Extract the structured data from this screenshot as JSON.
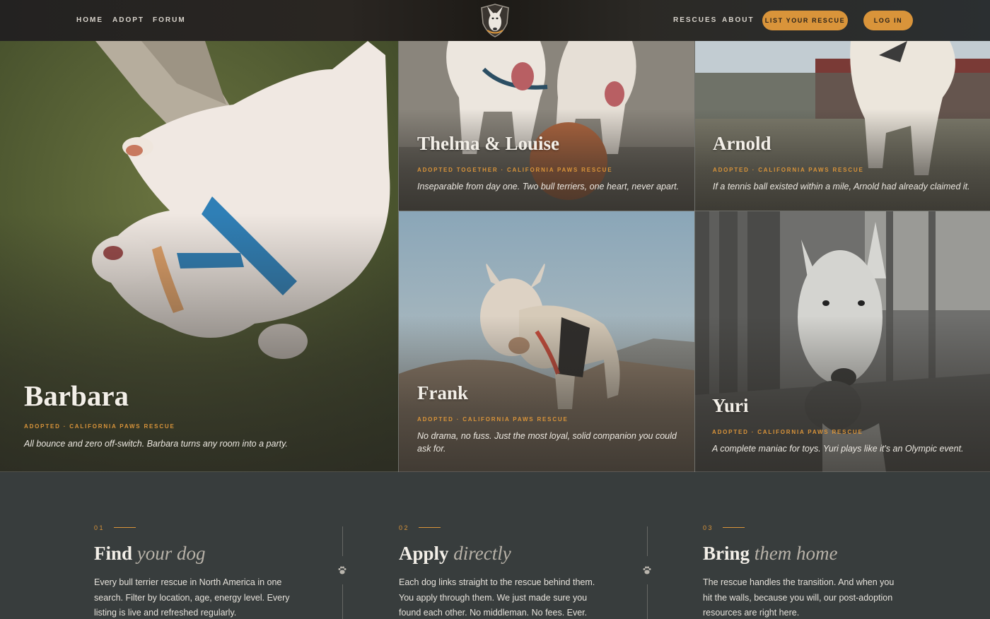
{
  "nav": {
    "left": [
      "HOME",
      "ADOPT",
      "FORUM"
    ],
    "right": [
      "RESCUES",
      "ABOUT"
    ],
    "cta": "LIST YOUR RESCUE",
    "login": "LOG IN",
    "logo_icon": "bull-terrier-shield-logo"
  },
  "colors": {
    "accent": "#d9943a",
    "background": "#383d3d",
    "text": "#f3efe8"
  },
  "dogs": [
    {
      "name": "Barbara",
      "tag": "ADOPTED · CALIFORNIA PAWS RESCUE",
      "desc": "All bounce and zero off-switch. Barbara turns any room into a party."
    },
    {
      "name": "Thelma & Louise",
      "tag": "ADOPTED TOGETHER · CALIFORNIA PAWS RESCUE",
      "desc": "Inseparable from day one. Two bull terriers, one heart, never apart."
    },
    {
      "name": "Arnold",
      "tag": "ADOPTED · CALIFORNIA PAWS RESCUE",
      "desc": "If a tennis ball existed within a mile, Arnold had already claimed it."
    },
    {
      "name": "Frank",
      "tag": "ADOPTED · CALIFORNIA PAWS RESCUE",
      "desc": "No drama, no fuss. Just the most loyal, solid companion you could ask for."
    },
    {
      "name": "Yuri",
      "tag": "ADOPTED · CALIFORNIA PAWS RESCUE",
      "desc": "A complete maniac for toys. Yuri plays like it's an Olympic event."
    }
  ],
  "steps": [
    {
      "num": "01",
      "title_bold": "Find",
      "title_italic": "your dog",
      "text": "Every bull terrier rescue in North America in one search. Filter by location, age, energy level. Every listing is live and refreshed regularly."
    },
    {
      "num": "02",
      "title_bold": "Apply",
      "title_italic": "directly",
      "text": "Each dog links straight to the rescue behind them. You apply through them. We just made sure you found each other. No middleman. No fees. Ever."
    },
    {
      "num": "03",
      "title_bold": "Bring",
      "title_italic": "them home",
      "text": "The rescue handles the transition. And when you hit the walls, because you will, our post-adoption resources are right here."
    }
  ]
}
